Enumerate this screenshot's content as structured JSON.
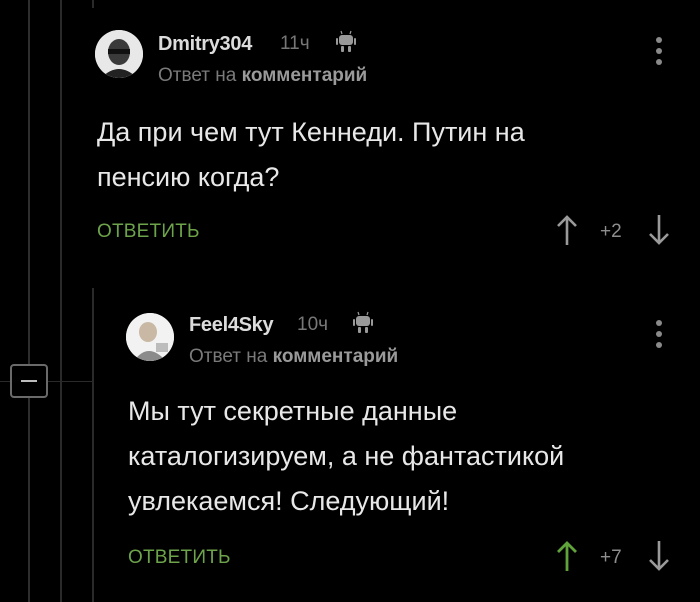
{
  "colors": {
    "background": "#000000",
    "thread_line": "#333333",
    "reply_green": "#6da34a",
    "arrow_up_active": "#5fa33a",
    "arrow_neutral": "#9a9a9a"
  },
  "comments": [
    {
      "author": "Dmitry304",
      "time": "11ч",
      "platform_icon": "android-icon",
      "reply_prefix": "Ответ на",
      "reply_target": "комментарий",
      "text": "Да при чем тут Кеннеди. Путин на\nпенсию когда?",
      "reply_label": "ОТВЕТИТЬ",
      "rating": "+2",
      "upvoted": false
    },
    {
      "author": "Feel4Sky",
      "time": "10ч",
      "platform_icon": "android-icon",
      "reply_prefix": "Ответ на",
      "reply_target": "комментарий",
      "text": "Мы тут секретные данные\nкаталогизируем, а не фантастикой\nувлекаемся! Следующий!",
      "reply_label": "ОТВЕТИТЬ",
      "rating": "+7",
      "upvoted": true
    }
  ]
}
